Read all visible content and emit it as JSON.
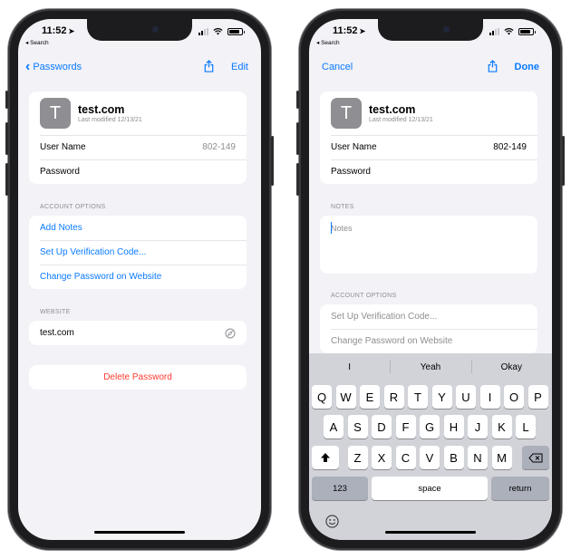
{
  "colors": {
    "accent": "#0a7aff",
    "destructive": "#ff3b30",
    "secondary": "#8e8e93",
    "background": "#f2f2f7"
  },
  "left": {
    "status": {
      "time": "11:52",
      "back_app": "◂ Search"
    },
    "nav": {
      "back_label": "Passwords",
      "edit_label": "Edit"
    },
    "site": {
      "initial": "T",
      "title": "test.com",
      "modified": "Last modified 12/13/21"
    },
    "credentials": {
      "username_label": "User Name",
      "username_value": "802-149",
      "password_label": "Password"
    },
    "account_options": {
      "header": "ACCOUNT OPTIONS",
      "items": [
        "Add Notes",
        "Set Up Verification Code...",
        "Change Password on Website"
      ]
    },
    "website": {
      "header": "WEBSITE",
      "value": "test.com"
    },
    "delete_label": "Delete Password"
  },
  "right": {
    "status": {
      "time": "11:52",
      "back_app": "◂ Search"
    },
    "nav": {
      "cancel_label": "Cancel",
      "done_label": "Done"
    },
    "site": {
      "initial": "T",
      "title": "test.com",
      "modified": "Last modified 12/13/21"
    },
    "credentials": {
      "username_label": "User Name",
      "username_value": "802-149",
      "password_label": "Password"
    },
    "notes": {
      "header": "NOTES",
      "placeholder": "Notes"
    },
    "account_options": {
      "header": "ACCOUNT OPTIONS",
      "items": [
        "Set Up Verification Code...",
        "Change Password on Website"
      ]
    },
    "keyboard": {
      "suggestions": [
        "I",
        "Yeah",
        "Okay"
      ],
      "row1": [
        "Q",
        "W",
        "E",
        "R",
        "T",
        "Y",
        "U",
        "I",
        "O",
        "P"
      ],
      "row2": [
        "A",
        "S",
        "D",
        "F",
        "G",
        "H",
        "J",
        "K",
        "L"
      ],
      "row3": [
        "Z",
        "X",
        "C",
        "V",
        "B",
        "N",
        "M"
      ],
      "numbers_label": "123",
      "space_label": "space",
      "return_label": "return"
    }
  }
}
